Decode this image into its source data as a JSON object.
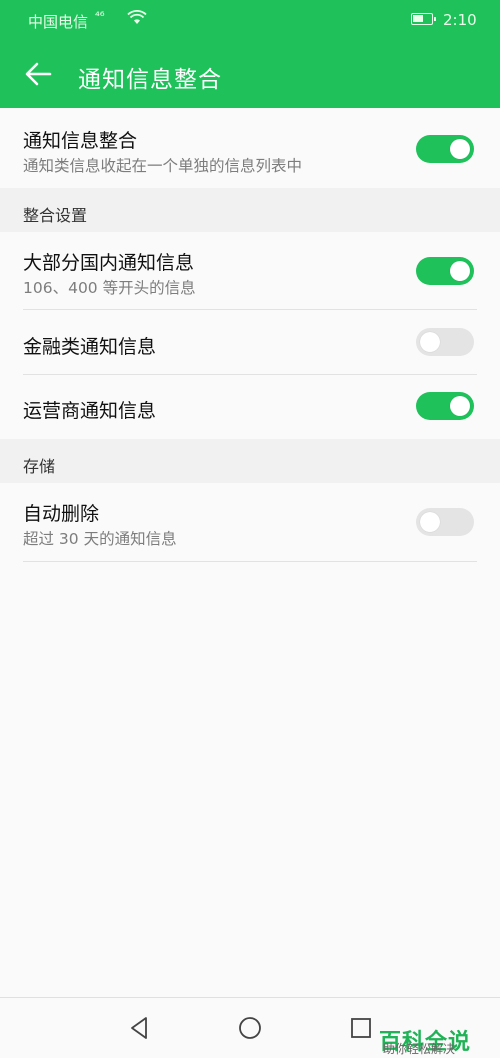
{
  "status_bar": {
    "carrier": "中国电信",
    "signal_label": "⁴⁶",
    "time": "2:10",
    "battery_level": 0.5
  },
  "app_bar": {
    "back_icon": "arrow-left-icon",
    "title": "通知信息整合"
  },
  "main_setting": {
    "label": "通知信息整合",
    "sub": "通知类信息收起在一个单独的信息列表中",
    "enabled": true
  },
  "sections": [
    {
      "header": "整合设置",
      "items": [
        {
          "label": "大部分国内通知信息",
          "sub": "106、400 等开头的信息",
          "enabled": true
        },
        {
          "label": "金融类通知信息",
          "enabled": false
        },
        {
          "label": "运营商通知信息",
          "enabled": true
        }
      ]
    },
    {
      "header": "存储",
      "items": [
        {
          "label": "自动删除",
          "sub": "超过 30 天的通知信息",
          "enabled": false
        }
      ]
    }
  ],
  "nav_bar": {
    "back": "triangle-back-icon",
    "home": "circle-home-icon",
    "recents": "square-recents-icon"
  },
  "watermark": {
    "main": "百科全说",
    "sub": "助你轻松解决"
  },
  "colors": {
    "accent": "#1fc25a",
    "toggle_off": "#e4e4e4"
  }
}
